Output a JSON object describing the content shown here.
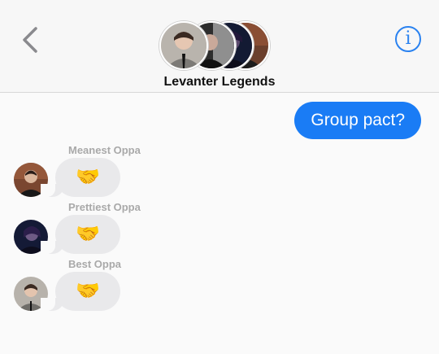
{
  "header": {
    "group_name": "Levanter Legends",
    "avatars": [
      "avatar-1",
      "avatar-2",
      "avatar-3",
      "avatar-4"
    ]
  },
  "messages": {
    "outgoing": {
      "text": "Group pact?"
    },
    "incoming": [
      {
        "sender": "Meanest Oppa",
        "emoji": "🤝"
      },
      {
        "sender": "Prettiest Oppa",
        "emoji": "🤝"
      },
      {
        "sender": "Best Oppa",
        "emoji": "🤝"
      }
    ]
  },
  "colors": {
    "accent": "#1a7cf5",
    "incoming_bubble": "#e9e9eb",
    "sender_name": "#a9a9a9"
  }
}
